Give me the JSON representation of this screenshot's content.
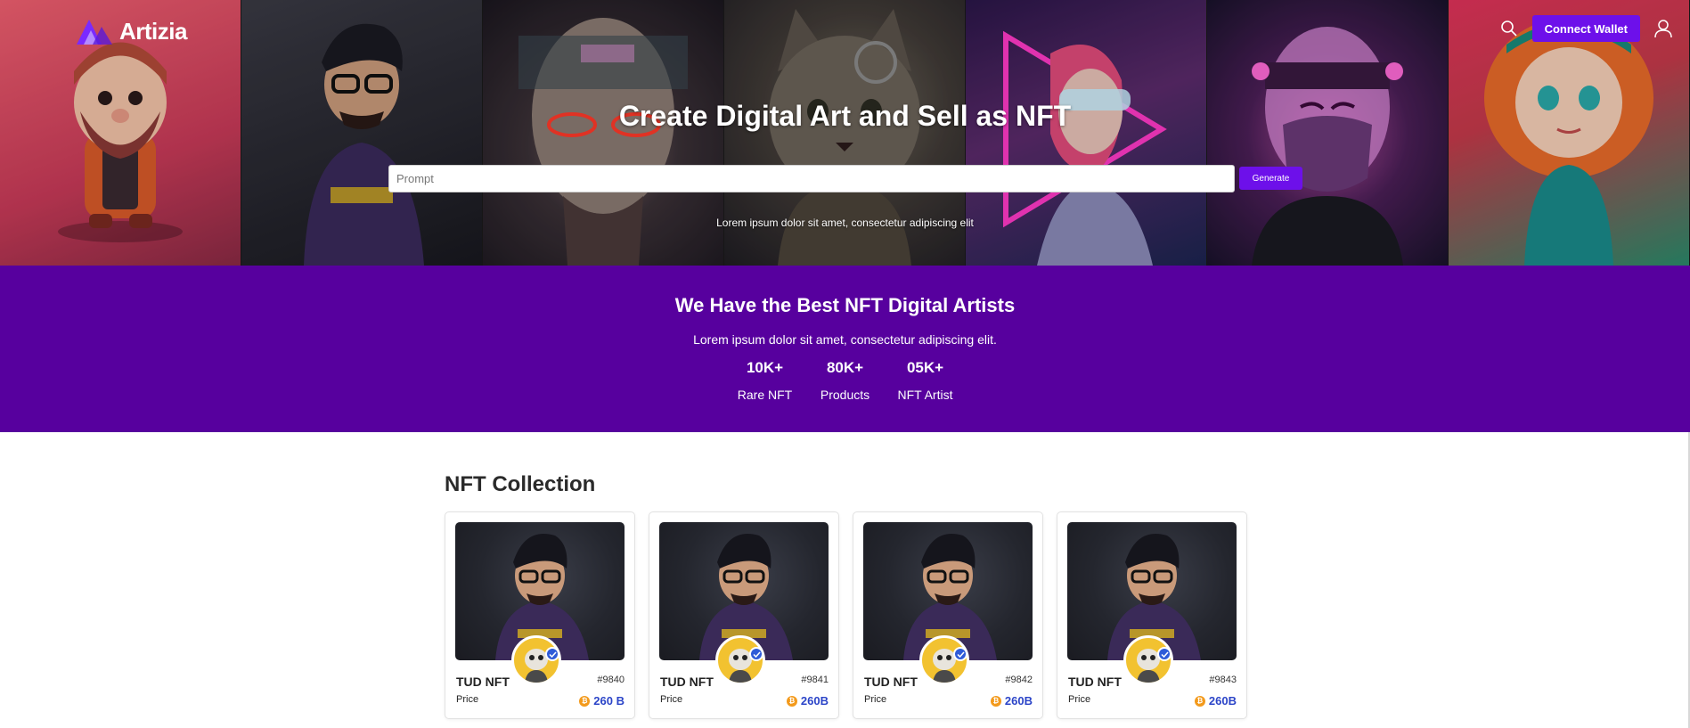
{
  "header": {
    "logo_text": "Artizia",
    "search_icon": "search-icon",
    "connect_wallet_label": "Connect Wallet",
    "user_icon": "user-icon"
  },
  "hero": {
    "title": "Create Digital Art and Sell as NFT",
    "prompt_placeholder": "Prompt",
    "prompt_value": "",
    "generate_label": "Generate",
    "subtitle": "Lorem ipsum dolor sit amet, consectetur adipiscing elit"
  },
  "artists": {
    "title": "We Have the Best NFT Digital Artists",
    "subtitle": "Lorem ipsum dolor sit amet, consectetur adipiscing elit.",
    "stats": [
      {
        "value": "10K+",
        "label": "Rare NFT"
      },
      {
        "value": "80K+",
        "label": "Products"
      },
      {
        "value": "05K+",
        "label": "NFT Artist"
      }
    ]
  },
  "collection": {
    "title": "NFT Collection",
    "cards": [
      {
        "name": "TUD NFT",
        "id": "#9840",
        "price_label": "Price",
        "price": "260 B"
      },
      {
        "name": "TUD NFT",
        "id": "#9841",
        "price_label": "Price",
        "price": "260B"
      },
      {
        "name": "TUD NFT",
        "id": "#9842",
        "price_label": "Price",
        "price": "260B"
      },
      {
        "name": "TUD NFT",
        "id": "#9843",
        "price_label": "Price",
        "price": "260B"
      }
    ]
  },
  "colors": {
    "accent": "#6d10ea",
    "artists_bg": "#57009e",
    "price_text": "#2c45c8",
    "coin": "#f39a1c",
    "verified": "#2f5bd8"
  }
}
